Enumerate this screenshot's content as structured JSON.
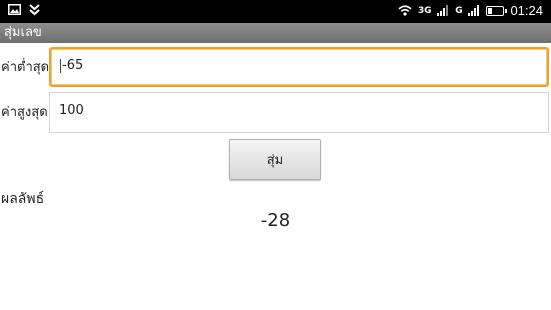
{
  "status_bar": {
    "network_label": "3G",
    "network_label_2": "G",
    "time": "01:24",
    "battery_level_fraction": 0.3
  },
  "app": {
    "title": "สุ่มเลข"
  },
  "form": {
    "min_label": "ค่าต่ำสุด",
    "min_value": "-65",
    "max_label": "ค่าสูงสุด",
    "max_value": "100",
    "random_button_label": "สุ่ม"
  },
  "result": {
    "label": "ผลลัพธ์",
    "value": "-28"
  },
  "colors": {
    "status_bar_bg": "#000000",
    "title_bar_bg": "#7f7f7f",
    "focus_border": "#f0a030"
  }
}
